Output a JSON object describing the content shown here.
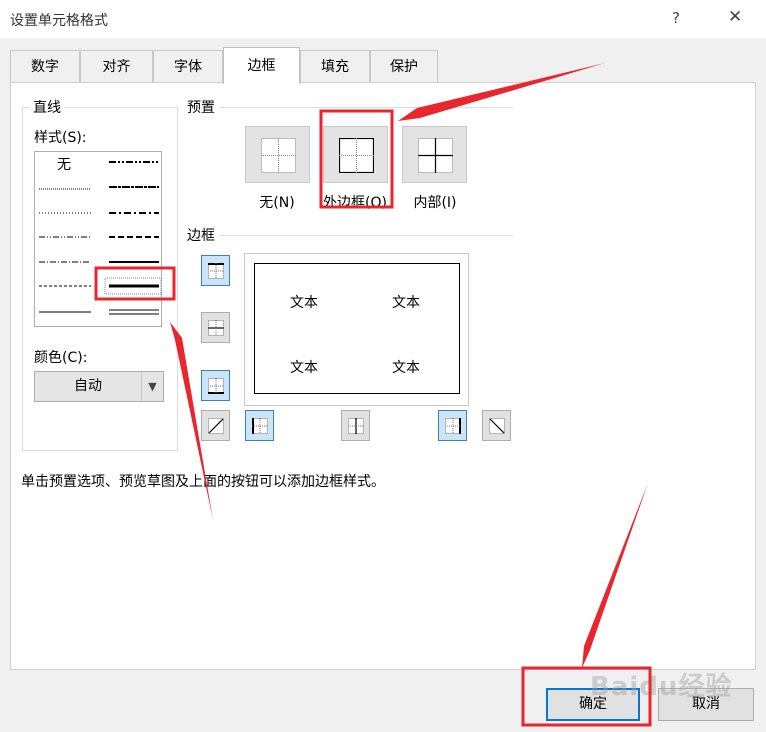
{
  "dialog": {
    "title": "设置单元格格式",
    "help": "?",
    "close": "✕"
  },
  "tabs": [
    {
      "label": "数字"
    },
    {
      "label": "对齐"
    },
    {
      "label": "字体"
    },
    {
      "label": "边框",
      "active": true
    },
    {
      "label": "填充"
    },
    {
      "label": "保护"
    }
  ],
  "line": {
    "group_label": "直线",
    "style_label": "样式(S):",
    "none_label": "无",
    "selected_style": "thick-solid",
    "color_label": "颜色(C):",
    "color_value": "自动"
  },
  "presets": {
    "label": "预置",
    "none": "无(N)",
    "outline": "外边框(O)",
    "inside": "内部(I)"
  },
  "border": {
    "label": "边框",
    "preview_text": [
      "文本",
      "文本",
      "文本",
      "文本"
    ],
    "active_buttons": [
      "top",
      "bottom",
      "left",
      "right"
    ]
  },
  "hint": "单击预置选项、预览草图及上面的按钮可以添加边框样式。",
  "footer": {
    "ok": "确定",
    "cancel": "取消"
  },
  "watermark": "Baidu经验",
  "colors": {
    "accent": "#0078d7",
    "annotation": "#e8262d",
    "toggled": "#cce4f7"
  }
}
